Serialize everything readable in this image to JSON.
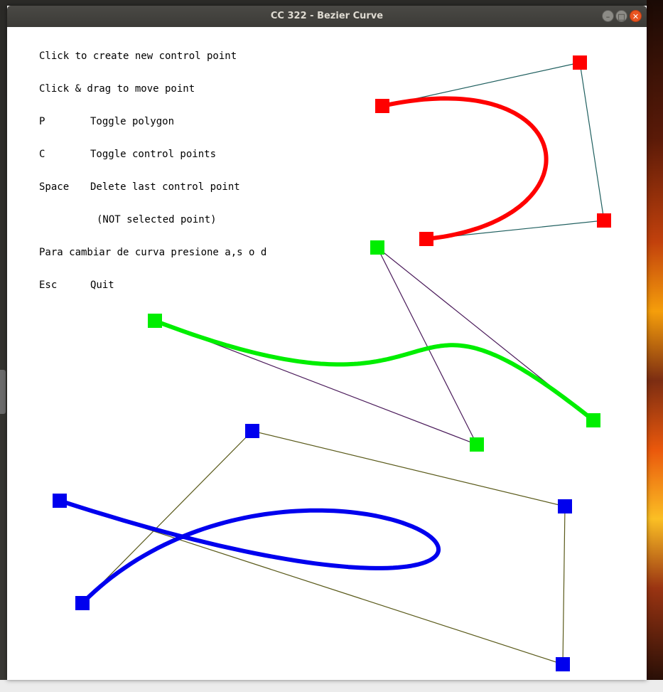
{
  "window": {
    "title": "CC 322 - Bezier Curve",
    "buttons": {
      "minimize_glyph": "–",
      "maximize_glyph": "□",
      "close_glyph": "✕"
    }
  },
  "help": {
    "click_create": "Click to create new control point",
    "click_drag": "Click & drag to move point",
    "polygon_key": "P",
    "polygon_text": "Toggle polygon",
    "control_key": "C",
    "control_text": "Toggle control points",
    "space_key": "Space",
    "space_text": "Delete last control point",
    "not_selected": "(NOT selected point)",
    "change_curve": "Para cambiar de curva presione a,s o d",
    "esc_key": "Esc",
    "esc_text": "Quit"
  },
  "curves": [
    {
      "name": "red-curve",
      "curve_color": "#ff0000",
      "polygon_color": "#1f5f5f",
      "points": [
        [
          528,
          111
        ],
        [
          806,
          50
        ],
        [
          840,
          272
        ],
        [
          590,
          298
        ]
      ]
    },
    {
      "name": "green-curve",
      "curve_color": "#00ee00",
      "polygon_color": "#4a1a5a",
      "points": [
        [
          208,
          413
        ],
        [
          661,
          587
        ],
        [
          521,
          310
        ],
        [
          825,
          553
        ]
      ]
    },
    {
      "name": "blue-curve",
      "curve_color": "#0000ee",
      "polygon_color": "#5a5a1a",
      "points": [
        [
          74,
          666
        ],
        [
          782,
          896
        ],
        [
          785,
          674
        ],
        [
          345,
          568
        ],
        [
          106,
          810
        ]
      ]
    }
  ],
  "colors": {
    "canvas_bg": "#ffffff",
    "text": "#000000",
    "title_bar": "#3c3b37",
    "close_button": "#e95420"
  }
}
